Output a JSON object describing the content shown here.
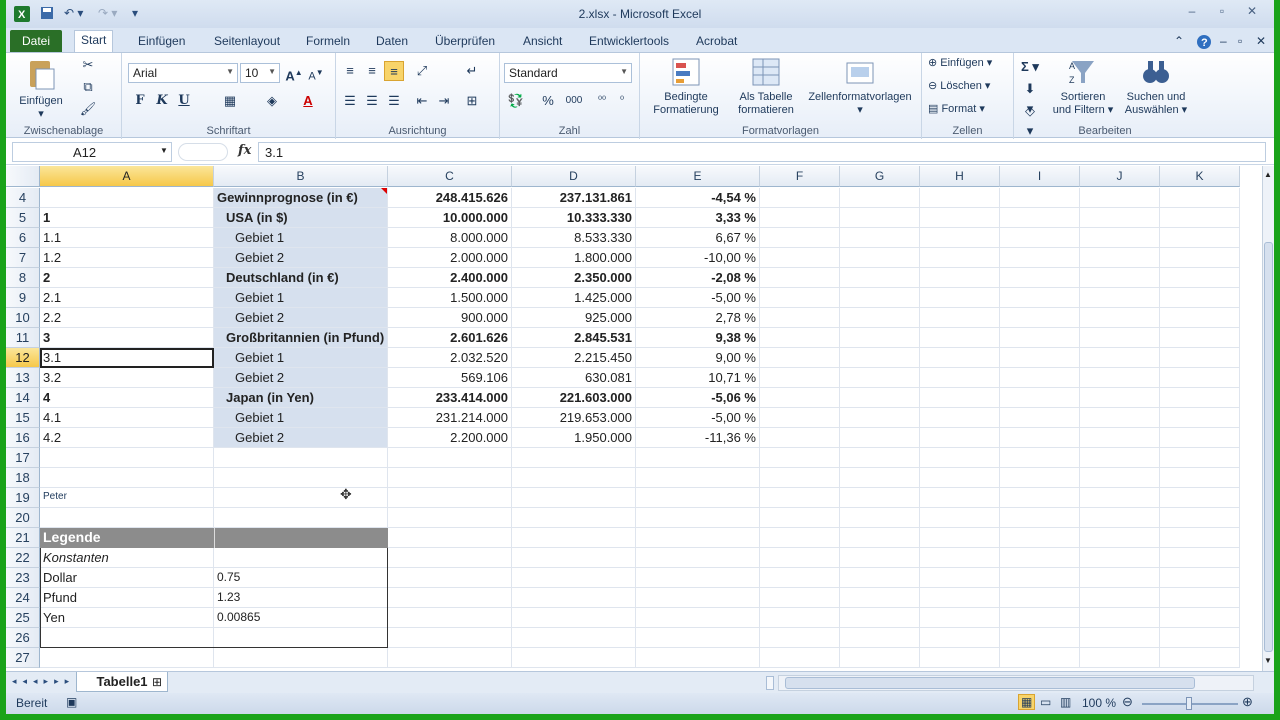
{
  "window": {
    "title": "2.xlsx - Microsoft Excel"
  },
  "ribbon_tabs": [
    "Datei",
    "Start",
    "Einfügen",
    "Seitenlayout",
    "Formeln",
    "Daten",
    "Überprüfen",
    "Ansicht",
    "Entwicklertools",
    "Acrobat"
  ],
  "ribbon": {
    "clipboard": {
      "paste": "Einfügen",
      "label": "Zwischenablage"
    },
    "font": {
      "name": "Arial",
      "size": "10",
      "label": "Schriftart",
      "bold": "F",
      "italic": "K",
      "underline": "U"
    },
    "alignment": {
      "label": "Ausrichtung"
    },
    "number": {
      "format": "Standard",
      "label": "Zahl",
      "percent": "%",
      "thousands": "000"
    },
    "styles": {
      "conditional": "Bedingte",
      "conditional2": "Formatierung",
      "table": "Als Tabelle",
      "table2": "formatieren",
      "cellstyles": "Zellenformatvorlagen",
      "label": "Formatvorlagen"
    },
    "cells": {
      "insert": "Einfügen",
      "delete": "Löschen",
      "format": "Format",
      "label": "Zellen"
    },
    "editing": {
      "sort": "Sortieren",
      "sort2": "und Filtern",
      "find": "Suchen und",
      "find2": "Auswählen",
      "label": "Bearbeiten"
    }
  },
  "formula_bar": {
    "name_box": "A12",
    "fx": "fx",
    "content": "3.1"
  },
  "columns": [
    "A",
    "B",
    "C",
    "D",
    "E",
    "F",
    "G",
    "H",
    "I",
    "J",
    "K"
  ],
  "rows": [
    {
      "n": "4",
      "A": "",
      "B": "Gewinnprognose  (in €)",
      "C": "248.415.626",
      "D": "237.131.861",
      "E": "-4,54 %",
      "bold": true,
      "indent": 0
    },
    {
      "n": "5",
      "A": "1",
      "B": "USA (in $)",
      "C": "10.000.000",
      "D": "10.333.330",
      "E": "3,33 %",
      "bold": true,
      "indent": 1
    },
    {
      "n": "6",
      "A": "1.1",
      "B": "Gebiet 1",
      "C": "8.000.000",
      "D": "8.533.330",
      "E": "6,67 %",
      "bold": false,
      "indent": 2
    },
    {
      "n": "7",
      "A": "1.2",
      "B": "Gebiet 2",
      "C": "2.000.000",
      "D": "1.800.000",
      "E": "-10,00 %",
      "bold": false,
      "indent": 2
    },
    {
      "n": "8",
      "A": "2",
      "B": "Deutschland (in €)",
      "C": "2.400.000",
      "D": "2.350.000",
      "E": "-2,08 %",
      "bold": true,
      "indent": 1
    },
    {
      "n": "9",
      "A": "2.1",
      "B": "Gebiet 1",
      "C": "1.500.000",
      "D": "1.425.000",
      "E": "-5,00 %",
      "bold": false,
      "indent": 2
    },
    {
      "n": "10",
      "A": "2.2",
      "B": "Gebiet 2",
      "C": "900.000",
      "D": "925.000",
      "E": "2,78 %",
      "bold": false,
      "indent": 2
    },
    {
      "n": "11",
      "A": "3",
      "B": "Großbritannien (in Pfund)",
      "C": "2.601.626",
      "D": "2.845.531",
      "E": "9,38 %",
      "bold": true,
      "indent": 1
    },
    {
      "n": "12",
      "A": "3.1",
      "B": "Gebiet 1",
      "C": "2.032.520",
      "D": "2.215.450",
      "E": "9,00 %",
      "bold": false,
      "indent": 2
    },
    {
      "n": "13",
      "A": "3.2",
      "B": "Gebiet 2",
      "C": "569.106",
      "D": "630.081",
      "E": "10,71 %",
      "bold": false,
      "indent": 2
    },
    {
      "n": "14",
      "A": "4",
      "B": "Japan (in Yen)",
      "C": "233.414.000",
      "D": "221.603.000",
      "E": "-5,06 %",
      "bold": true,
      "indent": 1
    },
    {
      "n": "15",
      "A": "4.1",
      "B": "Gebiet 1",
      "C": "231.214.000",
      "D": "219.653.000",
      "E": "-5,00 %",
      "bold": false,
      "indent": 2
    },
    {
      "n": "16",
      "A": "4.2",
      "B": "Gebiet 2",
      "C": "2.200.000",
      "D": "1.950.000",
      "E": "-11,36 %",
      "bold": false,
      "indent": 2
    }
  ],
  "empty_rows": [
    "17",
    "18",
    "19",
    "20",
    "21",
    "22",
    "23",
    "24",
    "25",
    "26",
    "27"
  ],
  "peter": "Peter",
  "legend": {
    "title": "Legende",
    "constants": "Konstanten",
    "items": [
      {
        "label": "Dollar",
        "value": "0.75"
      },
      {
        "label": "Pfund",
        "value": "1.23"
      },
      {
        "label": "Yen",
        "value": "0.00865"
      }
    ]
  },
  "sheet_tab": "Tabelle1",
  "status": {
    "ready": "Bereit",
    "zoom": "100 %"
  }
}
